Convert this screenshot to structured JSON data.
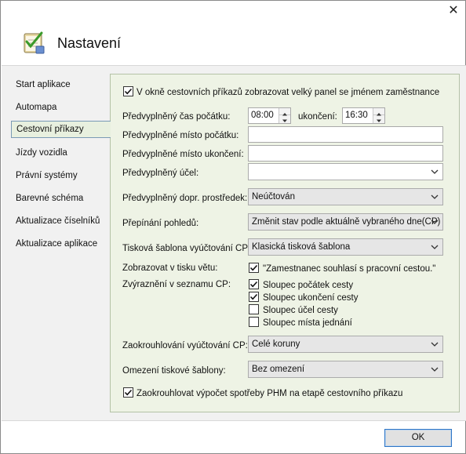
{
  "window": {
    "title": "Nastavení",
    "close_glyph": "✕",
    "app_icon": "notepad-checklist-icon"
  },
  "sidebar": {
    "items": [
      {
        "label": "Start aplikace",
        "selected": false
      },
      {
        "label": "Automapa",
        "selected": false
      },
      {
        "label": "Cestovní příkazy",
        "selected": true
      },
      {
        "label": "Jízdy vozidla",
        "selected": false
      },
      {
        "label": "Právní systémy",
        "selected": false
      },
      {
        "label": "Barevné schéma",
        "selected": false
      },
      {
        "label": "Aktualizace číselníků",
        "selected": false
      },
      {
        "label": "Aktualizace aplikace",
        "selected": false
      }
    ]
  },
  "panel": {
    "big_panel": {
      "label": "V okně cestovních příkazů zobrazovat velký panel se jménem zaměstnance",
      "checked": true
    },
    "start_time": {
      "label": "Předvyplněný čas počátku:",
      "value": "08:00"
    },
    "end_time": {
      "label": "ukončení:",
      "value": "16:30"
    },
    "start_place": {
      "label": "Předvyplněné místo počátku:",
      "value": ""
    },
    "end_place": {
      "label": "Předvyplněné místo ukončení:",
      "value": ""
    },
    "purpose": {
      "label": "Předvyplněný účel:",
      "value": ""
    },
    "transport": {
      "label": "Předvyplněný dopr. prostředek:",
      "value": "Neúčtován"
    },
    "view_switch": {
      "label": "Přepínání pohledů:",
      "value": "Změnit stav podle aktuálně vybraného dne(CP)"
    },
    "print_template": {
      "label": "Tisková šablona vyúčtování CP:",
      "value": "Klasická tisková šablona"
    },
    "print_sentence": {
      "label": "Zobrazovat v tisku větu:",
      "option": "\"Zamestnanec souhlasí s pracovní cestou.\"",
      "checked": true
    },
    "highlight": {
      "label": "Zvýraznění v seznamu CP:",
      "options": [
        {
          "label": "Sloupec počátek cesty",
          "checked": true
        },
        {
          "label": "Sloupec ukončení cesty",
          "checked": true
        },
        {
          "label": "Sloupec účel cesty",
          "checked": false
        },
        {
          "label": "Sloupec místa jednání",
          "checked": false
        }
      ]
    },
    "rounding": {
      "label": "Zaokrouhlování vyúčtování CP:",
      "value": "Celé koruny"
    },
    "template_limit": {
      "label": "Omezení tiskové šablony:",
      "value": "Bez omezení"
    },
    "fuel_rounding": {
      "label": "Zaokrouhlovat výpočet spotřeby PHM na etapě cestovního příkazu",
      "checked": true
    }
  },
  "footer": {
    "ok_label": "OK"
  }
}
